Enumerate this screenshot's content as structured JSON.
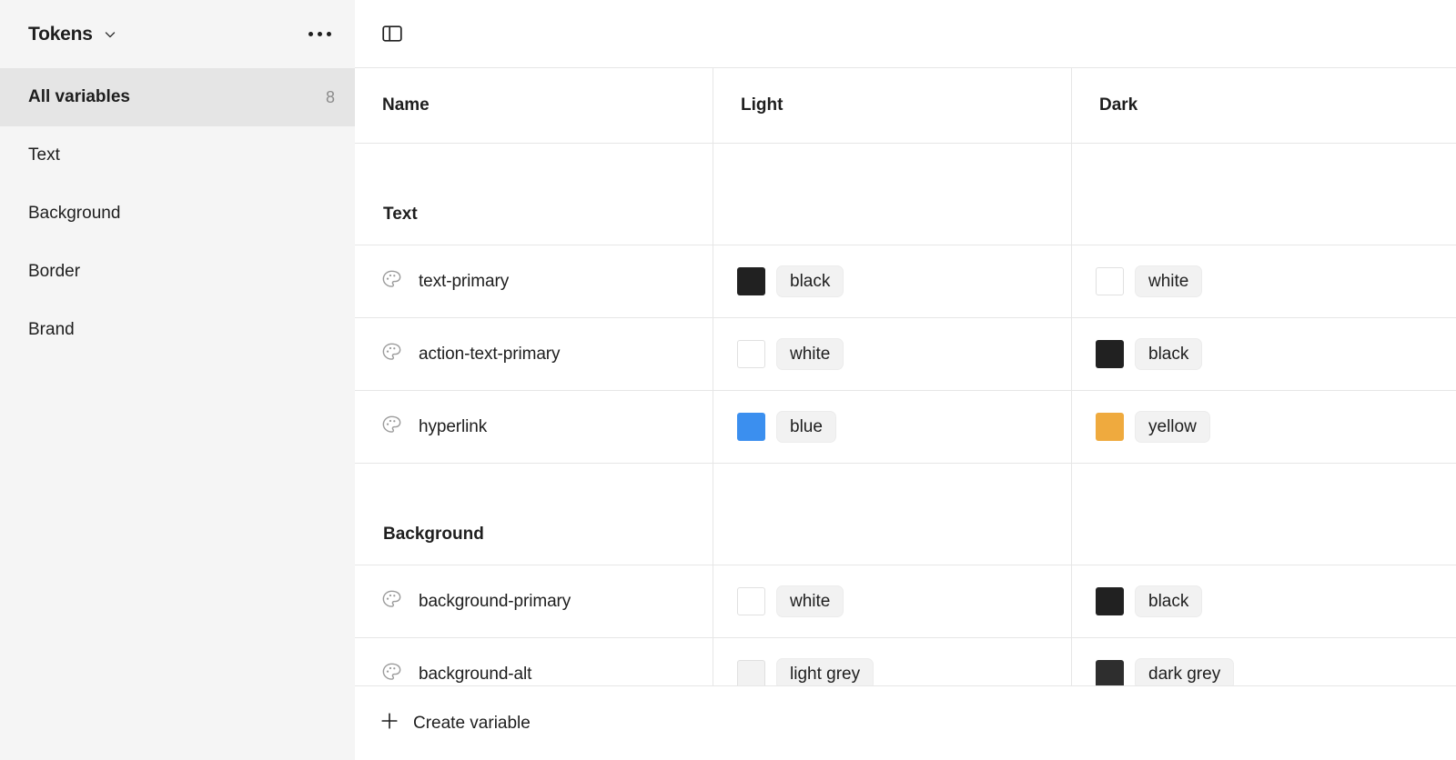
{
  "sidebar": {
    "title": "Tokens",
    "chevron_icon": "chevron-down-icon",
    "more_icon": "more-horizontal-icon",
    "all_variables": {
      "label": "All variables",
      "count": "8"
    },
    "groups": [
      {
        "label": "Text"
      },
      {
        "label": "Background"
      },
      {
        "label": "Border"
      },
      {
        "label": "Brand"
      }
    ]
  },
  "toolbar": {
    "sidebar_toggle_icon": "panel-left-icon"
  },
  "table": {
    "columns": {
      "name": "Name",
      "light": "Light",
      "dark": "Dark"
    },
    "variable_icon": "color-palette-icon",
    "sections": [
      {
        "title": "Text",
        "rows": [
          {
            "name": "text-primary",
            "light": {
              "label": "black",
              "hex": "#212121",
              "bordered": false
            },
            "dark": {
              "label": "white",
              "hex": "#ffffff",
              "bordered": true
            }
          },
          {
            "name": "action-text-primary",
            "light": {
              "label": "white",
              "hex": "#ffffff",
              "bordered": true
            },
            "dark": {
              "label": "black",
              "hex": "#212121",
              "bordered": false
            }
          },
          {
            "name": "hyperlink",
            "light": {
              "label": "blue",
              "hex": "#3b8fef",
              "bordered": false
            },
            "dark": {
              "label": "yellow",
              "hex": "#efaa3e",
              "bordered": false
            }
          }
        ]
      },
      {
        "title": "Background",
        "rows": [
          {
            "name": "background-primary",
            "light": {
              "label": "white",
              "hex": "#ffffff",
              "bordered": true
            },
            "dark": {
              "label": "black",
              "hex": "#212121",
              "bordered": false
            }
          },
          {
            "name": "background-alt",
            "light": {
              "label": "light grey",
              "hex": "#f2f2f2",
              "bordered": true
            },
            "dark": {
              "label": "dark grey",
              "hex": "#2e2e2e",
              "bordered": false
            }
          }
        ]
      }
    ]
  },
  "footer": {
    "create_label": "Create variable",
    "create_icon": "plus-icon"
  }
}
